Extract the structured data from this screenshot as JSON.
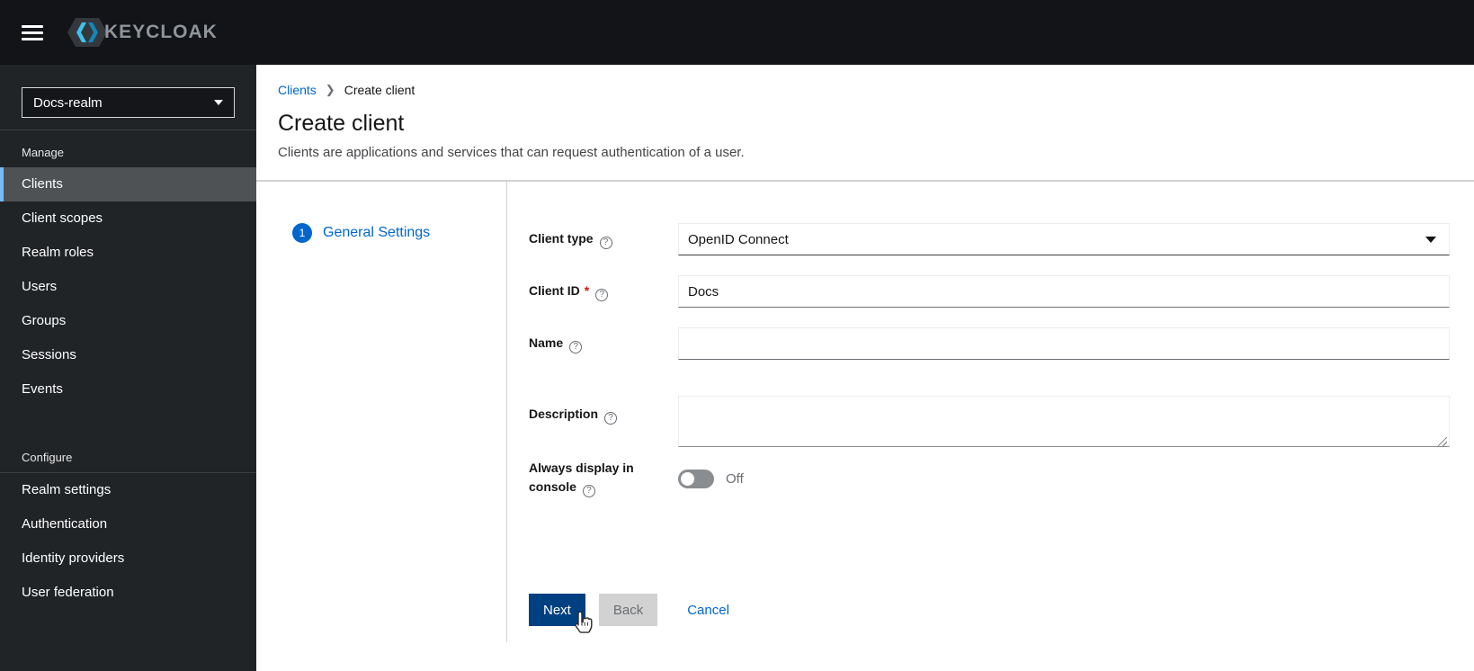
{
  "masthead": {
    "logo_text": "KEYCLOAK"
  },
  "sidebar": {
    "realm_selector": {
      "value": "Docs-realm"
    },
    "sections": [
      {
        "title": "Manage",
        "items": [
          {
            "label": "Clients",
            "selected": true
          },
          {
            "label": "Client scopes",
            "selected": false
          },
          {
            "label": "Realm roles",
            "selected": false
          },
          {
            "label": "Users",
            "selected": false
          },
          {
            "label": "Groups",
            "selected": false
          },
          {
            "label": "Sessions",
            "selected": false
          },
          {
            "label": "Events",
            "selected": false
          }
        ]
      },
      {
        "title": "Configure",
        "items": [
          {
            "label": "Realm settings",
            "selected": false
          },
          {
            "label": "Authentication",
            "selected": false
          },
          {
            "label": "Identity providers",
            "selected": false
          },
          {
            "label": "User federation",
            "selected": false
          }
        ]
      }
    ]
  },
  "breadcrumb": {
    "parent": "Clients",
    "current": "Create client"
  },
  "page": {
    "title": "Create client",
    "subtitle": "Clients are applications and services that can request authentication of a user."
  },
  "wizard": {
    "steps": [
      {
        "number": "1",
        "label": "General Settings"
      }
    ]
  },
  "form": {
    "client_type": {
      "label": "Client type",
      "value": "OpenID Connect"
    },
    "client_id": {
      "label": "Client ID",
      "required_marker": "*",
      "value": "Docs"
    },
    "name": {
      "label": "Name",
      "value": ""
    },
    "description": {
      "label": "Description",
      "value": ""
    },
    "always_display": {
      "label": "Always display in console",
      "state_label": "Off",
      "enabled": false
    }
  },
  "actions": {
    "next": "Next",
    "back": "Back",
    "cancel": "Cancel"
  },
  "colors": {
    "accent": "#0066cc",
    "primary_button": "#004080",
    "masthead_bg": "#121417",
    "sidebar_bg": "#212427",
    "selected_nav_bg": "#4f5255",
    "selected_nav_border": "#73bcf7",
    "required_marker": "#c9190b",
    "divider": "#d2d2d2",
    "logo_cyan_light": "#3fc3ee",
    "logo_cyan_dark": "#1486b8"
  }
}
